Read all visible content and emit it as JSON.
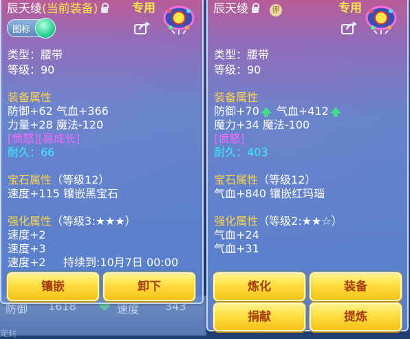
{
  "left": {
    "title": "辰天绫",
    "title_suffix": "(当前装备)",
    "exclusive_tag": "专用",
    "toggle_label": "图标",
    "type_line": "类型：腰带",
    "level_line": "等级：90",
    "equip_attr_header": "装备属性",
    "equip_attr_1": "防御+62 气血+366",
    "equip_attr_2": "力量+28 魔法-120",
    "special_tags": "[愤怒][易成长]",
    "durability": "耐久：66",
    "gem_header": "宝石属性",
    "gem_level": "（等级12）",
    "gem_line": "速度+115 镶嵌黑宝石",
    "enhance_header": "强化属性",
    "enhance_level": "（等级3:★★★）",
    "enhance_1": "速度+2",
    "enhance_2": "速度+3",
    "enhance_3": "速度+2",
    "enhance_duration": "持续到:10月7日 00:00",
    "buttons": [
      "镶嵌",
      "卸下"
    ]
  },
  "right": {
    "title": "辰天绫",
    "badge": "评",
    "exclusive_tag": "专用",
    "type_line": "类型：腰带",
    "level_line": "等级：90",
    "equip_attr_header": "装备属性",
    "equip_attr_1a": "防御+70",
    "equip_attr_1b": "气血+412",
    "equip_attr_2": "魔力+34 魔法-100",
    "special_tags": "[愤怒]",
    "durability": "耐久：403",
    "gem_header": "宝石属性",
    "gem_level": "（等级12）",
    "gem_line": "气血+840 镶嵌红玛瑙",
    "enhance_header": "强化属性",
    "enhance_level": "（等级2:★★☆）",
    "enhance_1": "气血+24",
    "enhance_2": "气血+31",
    "buttons": [
      "炼化",
      "装备",
      "捐献",
      "提炼"
    ]
  },
  "background": {
    "stat_label_1": "防御",
    "stat_value_1": "1618",
    "stat_label_2": "速度",
    "stat_value_2": "343",
    "bottom_word": "宠封"
  },
  "icons": [
    "lock-icon",
    "share-icon",
    "gem-ornament-icon",
    "upgrade-arrow-icon"
  ],
  "colors": {
    "section_header": "#ffd34a",
    "special_tag": "#ff66ff",
    "durability": "#38f0ff",
    "button_text": "#a83c0c",
    "arrow_up": "#3fe08a"
  }
}
